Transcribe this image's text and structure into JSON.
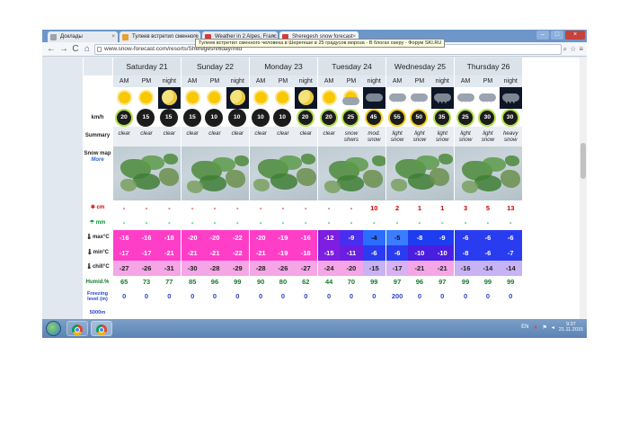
{
  "browser": {
    "tabs": [
      {
        "label": "Доклады",
        "favicon_color": "#9aa4b0"
      },
      {
        "label": "Тулеев встретил сменного",
        "favicon_color": "#e8a030"
      },
      {
        "label": "Weather in 2 Alpes, Franc",
        "favicon_color": "#d43a3a"
      },
      {
        "label": "Sheregesh snow forecast",
        "favicon_color": "#d43a3a"
      }
    ],
    "tooltip": "Тулеев встретил сменного человека в Шерегеше в 25 градусов мороза - В блогах озеру - Форум SKI.RU",
    "url": "www.snow-forecast.com/resorts/Sheregesh/6day/mid",
    "back_label": "←",
    "forward_label": "→",
    "reload_label": "C",
    "home_label": "⌂"
  },
  "forecast": {
    "days": [
      "Saturday 21",
      "Sunday 22",
      "Monday 23",
      "Tuesday 24",
      "Wednesday 25",
      "Thursday 26"
    ],
    "periods": [
      "AM",
      "PM",
      "night"
    ],
    "row_labels": {
      "wind": "km/h",
      "summary": "Summary",
      "snowmap": "Snow map",
      "snowmap_more": "More",
      "snow": "cm",
      "rain": "mm",
      "max": "max°C",
      "min": "min°C",
      "chill": "chill°C",
      "humid": "Humid.%",
      "freezing": "Freezing level (m)",
      "scroll_hint": "5000m"
    },
    "weather_icons": [
      "sun",
      "sun",
      "moon",
      "sun",
      "sun",
      "moon",
      "sun",
      "sun",
      "moon",
      "sun",
      "cloud-sun",
      "cloud-night",
      "snow-cloud",
      "snow-cloud",
      "snow-cloud-night",
      "snow-cloud",
      "snow-cloud",
      "snow-cloud-night"
    ],
    "wind_speed": [
      "20",
      "15",
      "15",
      "15",
      "10",
      "10",
      "10",
      "10",
      "20",
      "20",
      "25",
      "45",
      "55",
      "50",
      "35",
      "25",
      "30",
      "30"
    ],
    "wind_colors": [
      "#1c1c1c",
      "#1c1c1c",
      "#1c1c1c",
      "#1c1c1c",
      "#1c1c1c",
      "#1c1c1c",
      "#1c1c1c",
      "#1c1c1c",
      "#1c1c1c",
      "#1c1c1c",
      "#1c1c1c",
      "#1c1c1c",
      "#1c1c1c",
      "#1c1c1c",
      "#1c1c1c",
      "#1c1c1c",
      "#1c1c1c",
      "#1c1c1c"
    ],
    "wind_fill": [
      "#1c1c1c",
      "#1c1c1c",
      "#1c1c1c",
      "#1c1c1c",
      "#1c1c1c",
      "#1c1c1c",
      "#1c1c1c",
      "#1c1c1c",
      "#1c1c1c",
      "#1c1c1c",
      "#1c1c1c",
      "#1c1c1c",
      "#1c1c1c",
      "#1c1c1c",
      "#1c1c1c",
      "#1c1c1c",
      "#1c1c1c",
      "#1c1c1c"
    ],
    "wind_ring": [
      "#b4e04a",
      "#1c1c1c",
      "#1c1c1c",
      "#1c1c1c",
      "#1c1c1c",
      "#1c1c1c",
      "#1c1c1c",
      "#1c1c1c",
      "#b4e04a",
      "#b4e04a",
      "#b4e04a",
      "#f2d21c",
      "#f2d21c",
      "#f2d21c",
      "#b4e04a",
      "#b4e04a",
      "#b4e04a",
      "#b4e04a"
    ],
    "summary": [
      "clear",
      "clear",
      "clear",
      "clear",
      "clear",
      "clear",
      "clear",
      "clear",
      "clear",
      "clear",
      "snow shwrs",
      "mod. snow",
      "light snow",
      "light snow",
      "light snow",
      "light snow",
      "light snow",
      "heavy snow"
    ],
    "snow_cm": [
      "-",
      "-",
      "-",
      "-",
      "-",
      "-",
      "-",
      "-",
      "-",
      "-",
      "-",
      "10",
      "2",
      "1",
      "1",
      "3",
      "5",
      "13"
    ],
    "rain_mm": [
      "-",
      "-",
      "-",
      "-",
      "-",
      "-",
      "-",
      "-",
      "-",
      "-",
      "-",
      "-",
      "-",
      "-",
      "-",
      "-",
      "-",
      "-"
    ],
    "max_c": [
      "-16",
      "-16",
      "-18",
      "-20",
      "-20",
      "-22",
      "-20",
      "-19",
      "-16",
      "-12",
      "-9",
      "-4",
      "-5",
      "-8",
      "-9",
      "-6",
      "-6",
      "-6"
    ],
    "min_c": [
      "-17",
      "-17",
      "-21",
      "-21",
      "-21",
      "-22",
      "-21",
      "-19",
      "-18",
      "-15",
      "-11",
      "-6",
      "-6",
      "-10",
      "-10",
      "-8",
      "-6",
      "-7"
    ],
    "chill_c": [
      "-27",
      "-26",
      "-31",
      "-30",
      "-28",
      "-29",
      "-28",
      "-26",
      "-27",
      "-24",
      "-20",
      "-15",
      "-17",
      "-21",
      "-21",
      "-16",
      "-14",
      "-14"
    ],
    "humidity": [
      "65",
      "73",
      "77",
      "85",
      "96",
      "99",
      "90",
      "80",
      "62",
      "44",
      "70",
      "99",
      "97",
      "96",
      "97",
      "99",
      "99",
      "99"
    ],
    "freezing_level": [
      "0",
      "0",
      "0",
      "0",
      "0",
      "0",
      "0",
      "0",
      "0",
      "0",
      "0",
      "0",
      "200",
      "0",
      "0",
      "0",
      "0",
      "0"
    ],
    "temp_colors": {
      "max": [
        "#ff3ec8",
        "#ff3ec8",
        "#ff3ec8",
        "#ff3ec8",
        "#ff3ec8",
        "#ff3ec8",
        "#ff3ec8",
        "#ff3ec8",
        "#ff3ec8",
        "#7e1ee0",
        "#4a2ef0",
        "#2a5bff",
        "#2a5bff",
        "#1e3cf0",
        "#1e3cf0",
        "#2a3cf0",
        "#2a3cf0",
        "#2a3cf0"
      ],
      "min": [
        "#ff3ec8",
        "#ff3ec8",
        "#ff3ec8",
        "#ff3ec8",
        "#ff3ec8",
        "#ff3ec8",
        "#ff3ec8",
        "#ff3ec8",
        "#ff3ec8",
        "#7e1ee0",
        "#6a1ee0",
        "#2a3cf0",
        "#2a3cf0",
        "#4a1ee0",
        "#4a1ee0",
        "#2a3cf0",
        "#2a3cf0",
        "#2a3cf0"
      ],
      "chill": [
        "#f4a6e6",
        "#f4a6e6",
        "#f4a6e6",
        "#f4a6e6",
        "#f4a6e6",
        "#f4a6e6",
        "#f4a6e6",
        "#f4a6e6",
        "#f4a6e6",
        "#f4a6e6",
        "#f4a6e6",
        "#c7b2f4",
        "#d6b2f2",
        "#f4a6e6",
        "#f4a6e6",
        "#c7b2f4",
        "#c7b2f4",
        "#c7b2f4"
      ]
    }
  },
  "taskbar": {
    "lang": "EN",
    "time": "9:37",
    "date": "21.11.2015"
  }
}
